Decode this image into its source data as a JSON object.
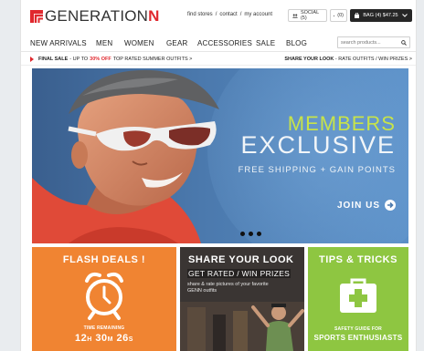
{
  "header": {
    "logo_main": "GENERATION",
    "logo_accent": "N",
    "links": [
      "find stores",
      "/",
      "contact",
      "/",
      "my account"
    ],
    "social_label": "SOCIAL (5)",
    "wishlist_count": "(0)",
    "bag_label": "BAG (4)  $47.25"
  },
  "nav": {
    "items": [
      "NEW ARRIVALS",
      "MEN",
      "WOMEN",
      "GEAR",
      "ACCESSORIES",
      "SALE",
      "BLOG"
    ],
    "search_placeholder": "search products..."
  },
  "promo": {
    "left_bold": "FINAL SALE",
    "left_mid": "- UP TO",
    "left_highlight": "30% OFF",
    "left_tail": "TOP RATED  SUMMER OUTFITS  >",
    "right_bold": "SHARE YOUR LOOK",
    "right_tail": " - RATE OUTFITS / WIN PRIZES  >"
  },
  "hero": {
    "line1": "MEMBERS",
    "line2": "EXCLUSIVE",
    "line3": "FREE SHIPPING + GAIN POINTS",
    "cta": "JOIN US"
  },
  "tiles": {
    "flash": {
      "title": "FLASH DEALS !",
      "time_label": "TIME REMAINING",
      "hours": "12",
      "minutes": "30",
      "seconds": "26",
      "h_unit": "H",
      "m_unit": "M",
      "s_unit": "S"
    },
    "share": {
      "title": "SHARE YOUR LOOK",
      "subtitle": "GET RATED / WIN PRIZES",
      "description": "share & rate pictures of your favorite GENN outfits"
    },
    "tips": {
      "title": "TIPS & TRICKS",
      "subtitle1": "SAFETY GUIDE FOR",
      "subtitle2": "SPORTS ENTHUSIASTS"
    }
  },
  "colors": {
    "brand_red": "#e0282e",
    "flash_orange": "#f08432",
    "tips_green": "#8ec641",
    "share_dark": "#2c2a2a",
    "hero_blue": "#4b79ad",
    "members_green": "#c7e34a"
  }
}
